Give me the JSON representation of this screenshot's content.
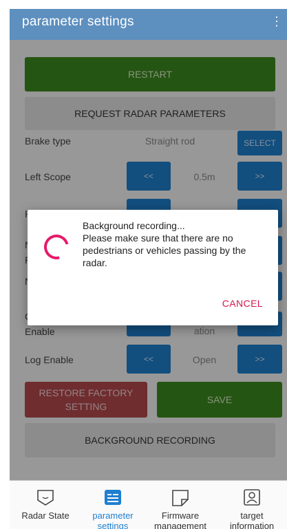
{
  "appbar": {
    "title": "parameter settings",
    "menu_icon": "overflow-menu-icon"
  },
  "buttons": {
    "restart": "RESTART",
    "request_params": "REQUEST RADAR PARAMETERS",
    "restore_factory": "RESTORE FACTORY\nSETTING",
    "save": "SAVE",
    "background_recording": "BACKGROUND RECORDING"
  },
  "rows": {
    "brake_type": {
      "label": "Brake type",
      "value": "Straight rod",
      "button": "SELECT"
    },
    "left_scope": {
      "label": "Left Scope",
      "value": "0.5m",
      "prev": "<<",
      "next": ">>"
    },
    "row3": {
      "label": "R",
      "prev": "<<",
      "next": ">>"
    },
    "row4": {
      "label": "N\nR"
    },
    "row5": {
      "label": "N"
    },
    "row6": {
      "label": "C\nEnable",
      "value": "ation",
      "prev": "<<",
      "next": ">>"
    },
    "log_enable": {
      "label": "Log Enable",
      "value": "Open",
      "prev": "<<",
      "next": ">>"
    }
  },
  "dialog": {
    "message": "Background recording...\n Please make sure that there are no pedestrians or vehicles passing by the radar.",
    "cancel": "CANCEL"
  },
  "nav": [
    {
      "label": "Radar State",
      "icon": "radar-state-icon",
      "active": false
    },
    {
      "label": "parameter settings",
      "icon": "parameter-settings-icon",
      "active": true
    },
    {
      "label": "Firmware management",
      "icon": "firmware-icon",
      "active": false
    },
    {
      "label": "target information",
      "icon": "target-info-icon",
      "active": false
    }
  ],
  "colors": {
    "appbar": "#5d8fbf",
    "green": "#3c8a1e",
    "red": "#b44a4e",
    "blue": "#1d7ecb",
    "accent": "#e61a6b"
  }
}
